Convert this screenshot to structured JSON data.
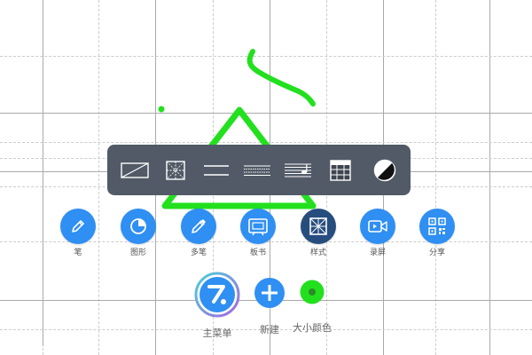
{
  "style_panel": {
    "options": [
      {
        "icon": "blank-background-icon"
      },
      {
        "icon": "tian-grid-icon"
      },
      {
        "icon": "double-line-icon"
      },
      {
        "icon": "pinyin-lines-icon"
      },
      {
        "icon": "music-staff-icon"
      },
      {
        "icon": "calendar-table-icon"
      },
      {
        "icon": "background-color-icon"
      }
    ]
  },
  "toolbar": {
    "tools": [
      {
        "label": "笔",
        "icon": "pen-icon"
      },
      {
        "label": "图形",
        "icon": "shape-pie-icon"
      },
      {
        "label": "多笔",
        "icon": "multi-pen-icon"
      },
      {
        "label": "板书",
        "icon": "blackboard-icon"
      },
      {
        "label": "样式",
        "icon": "grid-style-icon",
        "active": true
      },
      {
        "label": "录屏",
        "icon": "screen-record-icon"
      },
      {
        "label": "分享",
        "icon": "qr-code-icon"
      }
    ]
  },
  "bottom": {
    "main_menu_label": "主菜单",
    "new_label": "新建",
    "size_color_label": "大小颜色"
  },
  "colors": {
    "accent": "#2f8ff2",
    "active": "#264d7e",
    "ink": "#22e01e",
    "panel": "#515a66"
  }
}
